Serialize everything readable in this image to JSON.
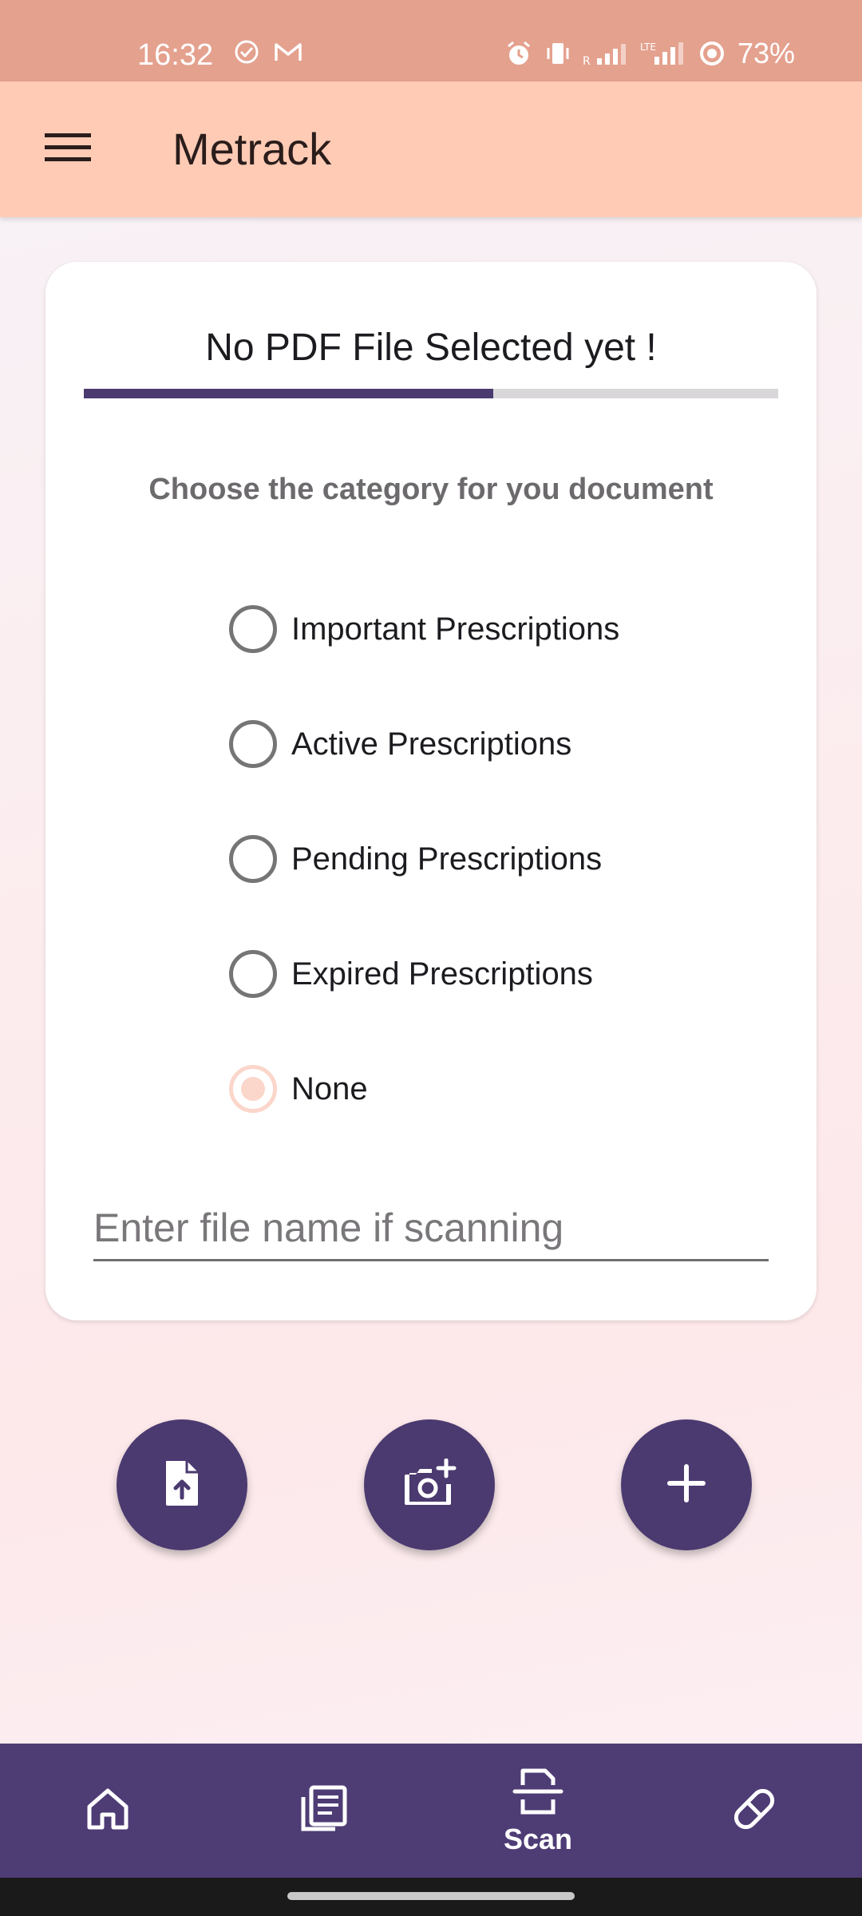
{
  "status_bar": {
    "time": "16:32",
    "battery": "73%",
    "left_icons": [
      "check-circle-icon",
      "gmail-icon"
    ],
    "right_icons": [
      "alarm-icon",
      "vibrate-icon",
      "signal-roaming-icon",
      "signal-lte-icon",
      "data-saver-icon"
    ]
  },
  "app_bar": {
    "title": "Metrack",
    "menu_icon": "hamburger-menu-icon"
  },
  "card": {
    "pdf_status": "No PDF File Selected yet !",
    "progress_percent": 59,
    "category_heading": "Choose the category for you document",
    "categories": [
      {
        "label": "Important Prescriptions",
        "selected": false
      },
      {
        "label": "Active Prescriptions",
        "selected": false
      },
      {
        "label": "Pending Prescriptions",
        "selected": false
      },
      {
        "label": "Expired Prescriptions",
        "selected": false
      },
      {
        "label": "None",
        "selected": true
      }
    ],
    "file_name_input": {
      "value": "",
      "placeholder": "Enter file name if scanning"
    }
  },
  "actions": [
    {
      "name": "upload-file-button",
      "icon": "file-upload-icon"
    },
    {
      "name": "camera-button",
      "icon": "camera-add-icon"
    },
    {
      "name": "add-button",
      "icon": "plus-icon"
    }
  ],
  "bottom_nav": {
    "items": [
      {
        "name": "home",
        "icon": "home-icon",
        "label": ""
      },
      {
        "name": "documents",
        "icon": "documents-icon",
        "label": ""
      },
      {
        "name": "scan",
        "icon": "scan-icon",
        "label": "Scan",
        "active": true
      },
      {
        "name": "medicine",
        "icon": "pill-icon",
        "label": ""
      }
    ]
  },
  "colors": {
    "status_bar": "#e4a18e",
    "app_bar": "#ffcbb5",
    "primary": "#4b3a70",
    "radio_selected": "#fbd6ca"
  }
}
